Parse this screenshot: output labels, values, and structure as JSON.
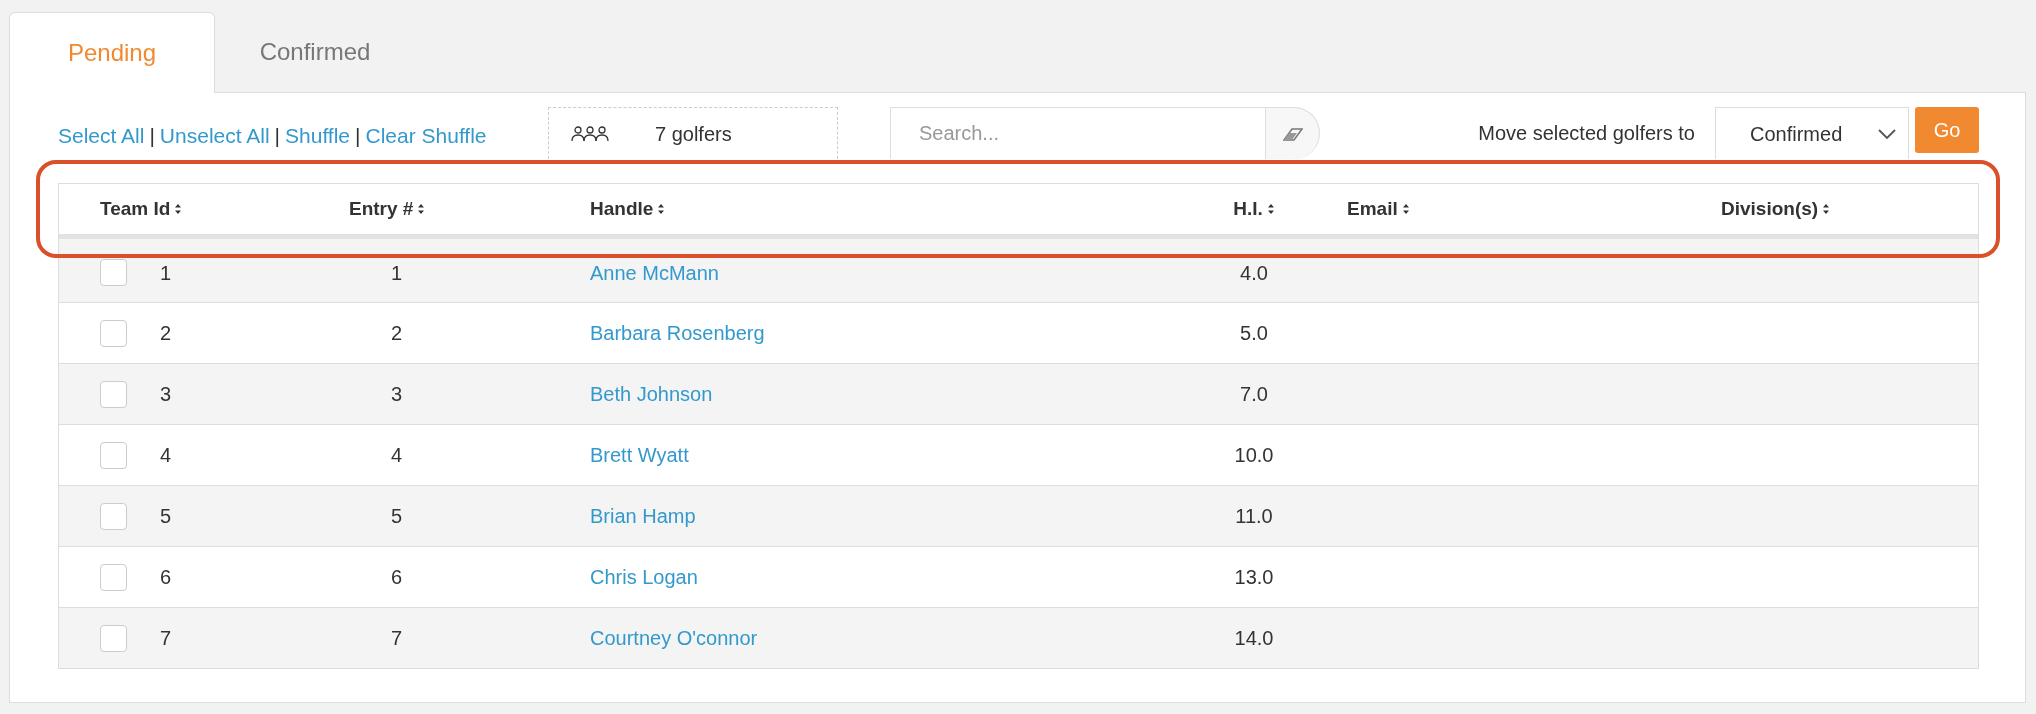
{
  "tabs": [
    {
      "label": "Pending",
      "selected": true
    },
    {
      "label": "Confirmed",
      "selected": false
    }
  ],
  "toolbar": {
    "links": [
      "Select All",
      "Unselect All",
      "Shuffle",
      "Clear Shuffle"
    ],
    "separator": "|",
    "golfer_count": "7 golfers",
    "search": {
      "placeholder": "Search..."
    },
    "move_label": "Move selected golfers to",
    "move_target": "Confirmed",
    "go_button": "Go"
  },
  "table": {
    "columns": [
      "Team Id",
      "Entry #",
      "Handle",
      "H.I.",
      "Email",
      "Division(s)"
    ],
    "rows": [
      {
        "team_id": "1",
        "entry": "1",
        "handle": "Anne McMann",
        "hi": "4.0",
        "checked": false
      },
      {
        "team_id": "2",
        "entry": "2",
        "handle": "Barbara Rosenberg",
        "hi": "5.0",
        "checked": false
      },
      {
        "team_id": "3",
        "entry": "3",
        "handle": "Beth Johnson",
        "hi": "7.0",
        "checked": false
      },
      {
        "team_id": "4",
        "entry": "4",
        "handle": "Brett Wyatt",
        "hi": "10.0",
        "checked": false
      },
      {
        "team_id": "5",
        "entry": "5",
        "handle": "Brian Hamp",
        "hi": "11.0",
        "checked": false
      },
      {
        "team_id": "6",
        "entry": "6",
        "handle": "Chris Logan",
        "hi": "13.0",
        "checked": false
      },
      {
        "team_id": "7",
        "entry": "7",
        "handle": "Courtney O'connor",
        "hi": "14.0",
        "checked": false
      }
    ]
  }
}
